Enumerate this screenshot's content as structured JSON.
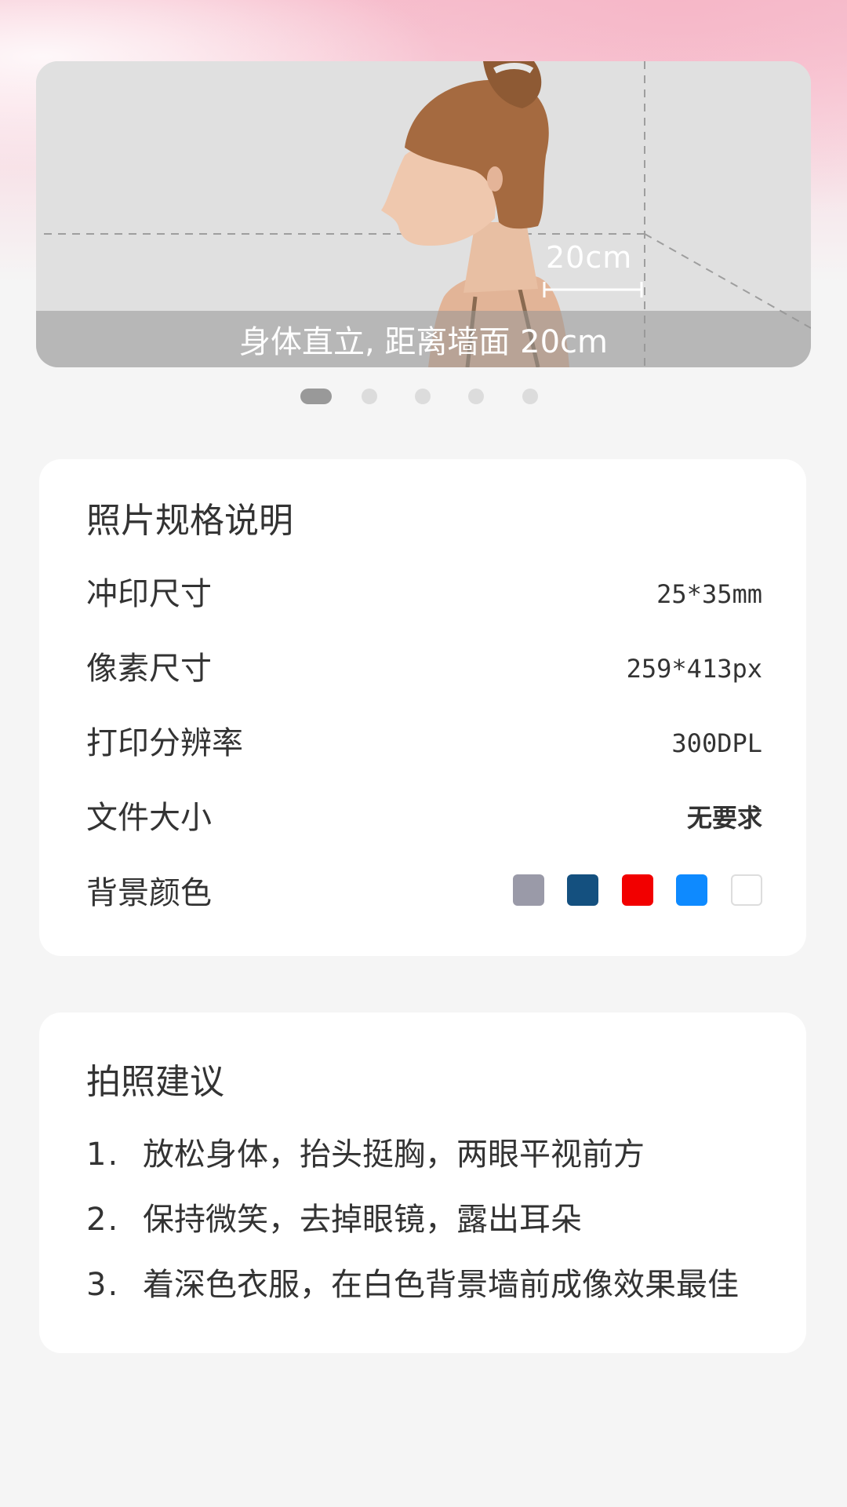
{
  "carousel": {
    "dimension_label": "20cm",
    "caption": "身体直立, 距离墙面 20cm",
    "active_index": 0,
    "slides": 5
  },
  "spec": {
    "title": "照片规格说明",
    "rows": [
      {
        "label": "冲印尺寸",
        "value": "25*35mm"
      },
      {
        "label": "像素尺寸",
        "value": "259*413px"
      },
      {
        "label": "打印分辨率",
        "value": "300DPL"
      },
      {
        "label": "文件大小",
        "value": "无要求"
      },
      {
        "label": "背景颜色"
      }
    ],
    "bg_colors": [
      "#9a9aa8",
      "#14507f",
      "#f20000",
      "#0e8aff",
      "#ffffff"
    ]
  },
  "tips": {
    "title": "拍照建议",
    "items": [
      {
        "num": "1.",
        "text": "放松身体，抬头挺胸，两眼平视前方"
      },
      {
        "num": "2.",
        "text": "保持微笑，去掉眼镜，露出耳朵"
      },
      {
        "num": "3.",
        "text": "着深色衣服，在白色背景墙前成像效果最佳"
      }
    ]
  }
}
